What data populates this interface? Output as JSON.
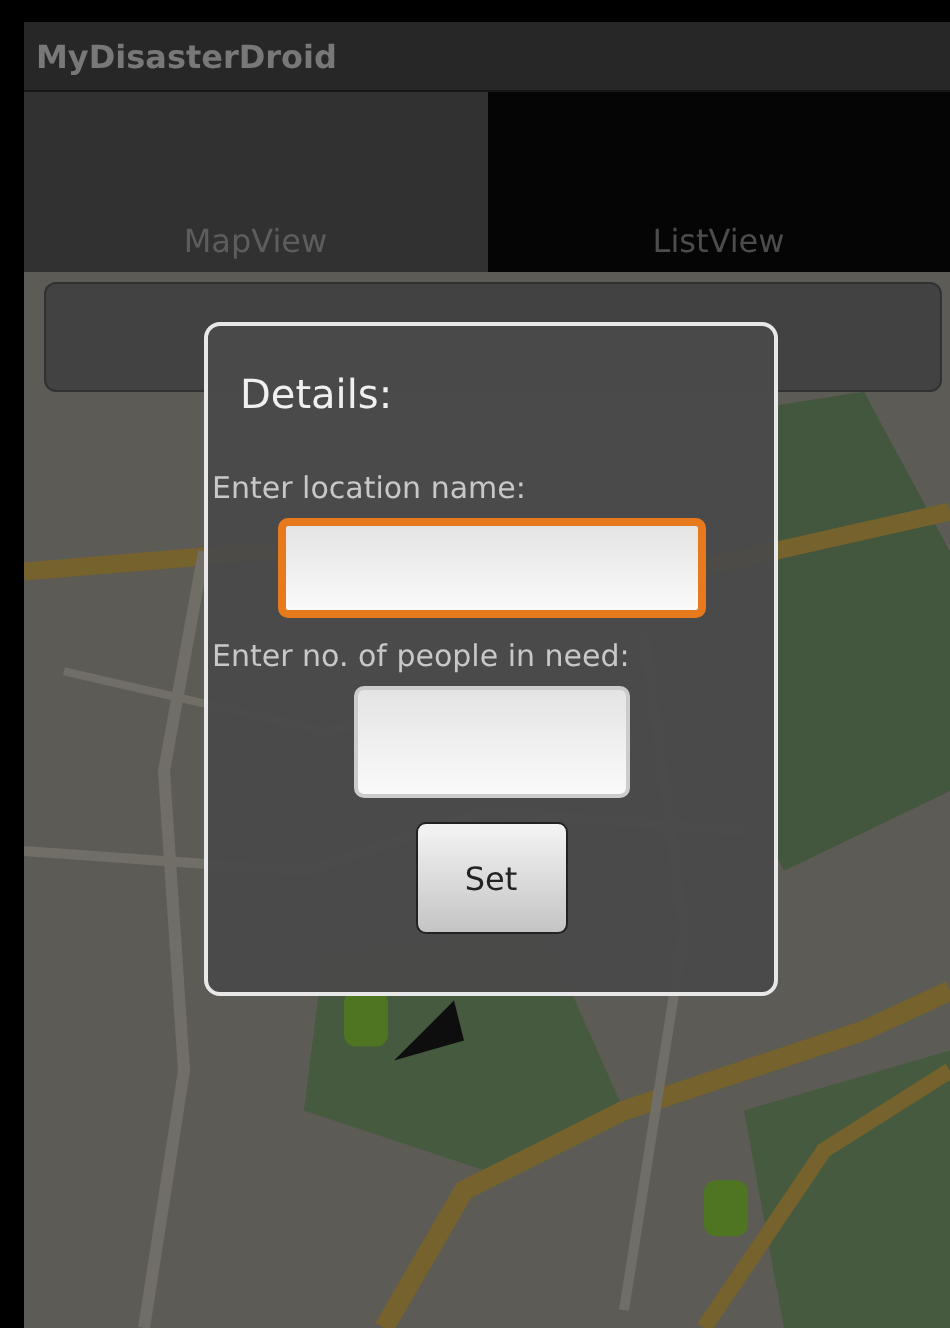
{
  "app_bar": {
    "title": "MyDisasterDroid"
  },
  "tabs": [
    {
      "label": "MapView",
      "selected": true
    },
    {
      "label": "ListView",
      "selected": false
    }
  ],
  "dialog": {
    "title": "Details:",
    "fields": [
      {
        "label": "Enter location name:",
        "focused": true,
        "kind": "wide"
      },
      {
        "label": "Enter no. of people in need:",
        "focused": false,
        "kind": "narrow"
      }
    ],
    "button": "Set"
  }
}
